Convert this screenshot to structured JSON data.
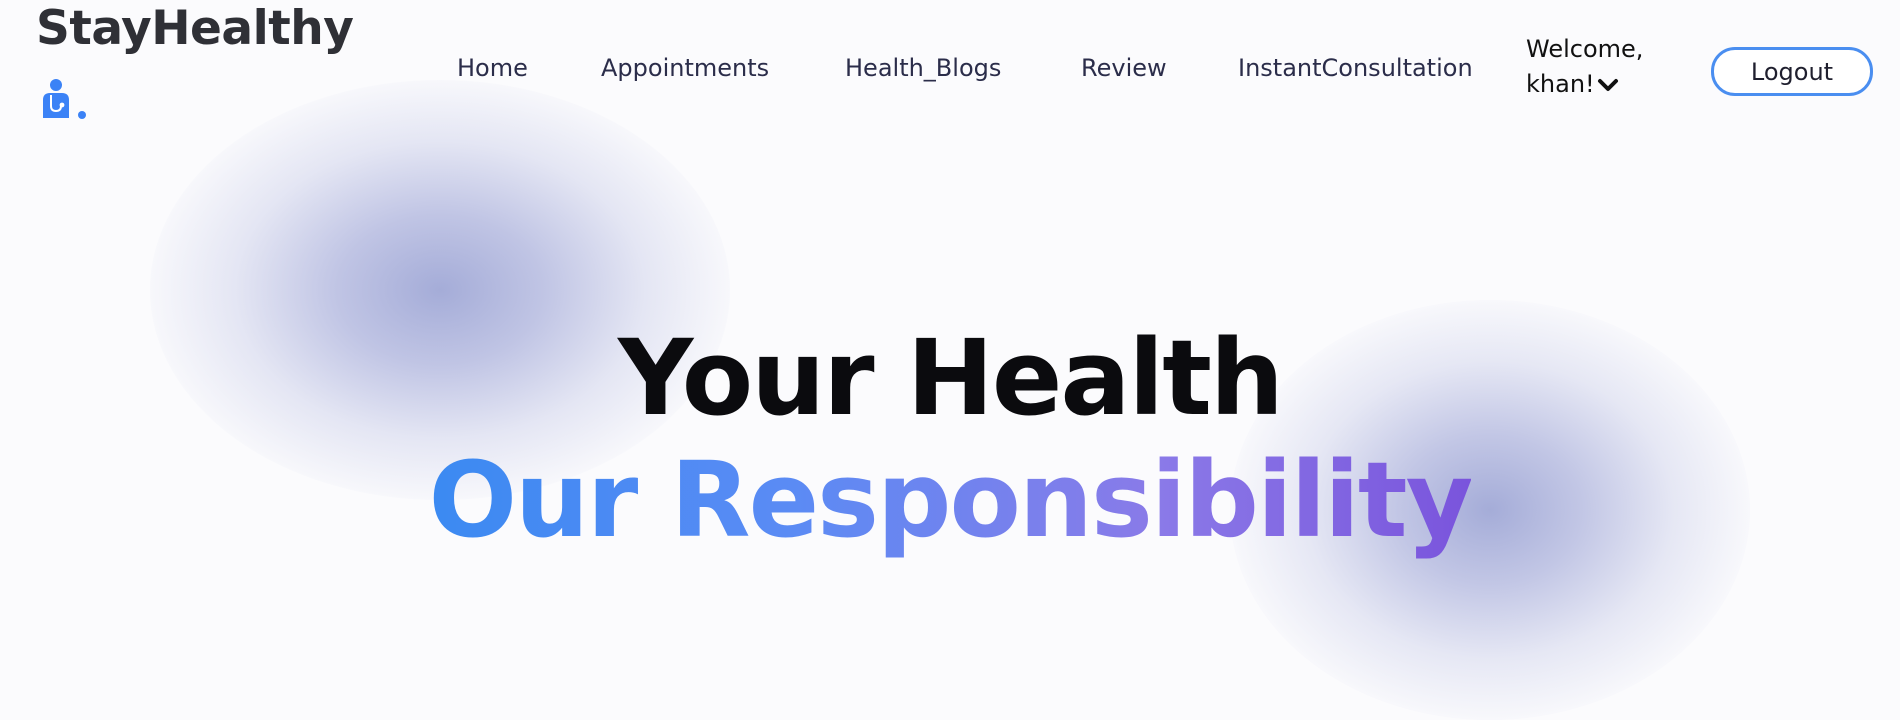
{
  "brand": {
    "name": "StayHealthy",
    "icon": "doctor-icon"
  },
  "nav": {
    "items": [
      {
        "label": "Home"
      },
      {
        "label": "Appointments"
      },
      {
        "label": "Health_Blogs"
      },
      {
        "label": "Review"
      },
      {
        "label": "InstantConsultation"
      }
    ]
  },
  "user": {
    "welcome_line1": "Welcome,",
    "welcome_line2": "khan!",
    "dropdown_icon": "chevron-down-icon",
    "logout_label": "Logout"
  },
  "hero": {
    "line1": "Your Health",
    "line2": "Our Responsibility"
  },
  "colors": {
    "accent": "#3b8af2",
    "accent_end": "#7a54dc",
    "logout_border": "#4a8ef0",
    "heading": "#0b0b0e"
  }
}
